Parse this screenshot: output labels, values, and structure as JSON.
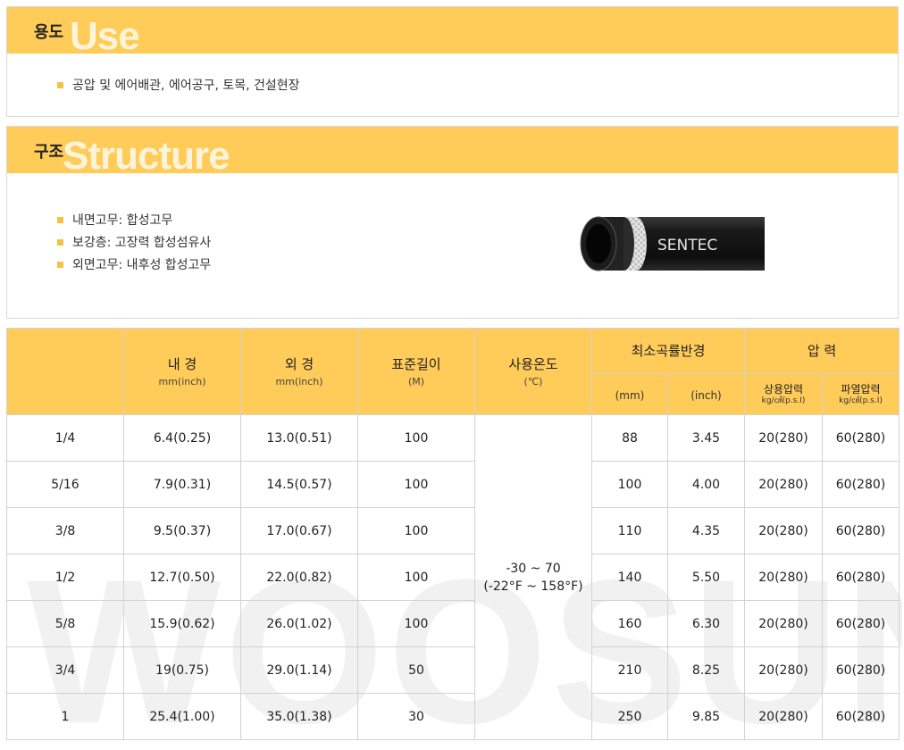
{
  "use_section": {
    "title": "용도",
    "ghost": "Use",
    "items": [
      "공압 및 에어배관, 에어공구, 토목, 건설현장"
    ]
  },
  "structure_section": {
    "title": "구조",
    "ghost": "Structure",
    "items": [
      "내면고무: 합성고무",
      "보강층: 고장력 합성섬유사",
      "외면고무: 내후성 합성고무"
    ],
    "hose_brand": "SENTEC"
  },
  "table": {
    "headers": {
      "inner_diameter": "내 경",
      "inner_diameter_unit": "mm(inch)",
      "outer_diameter": "외 경",
      "outer_diameter_unit": "mm(inch)",
      "length": "표준길이",
      "length_unit": "(M)",
      "temperature": "사용온도",
      "temperature_unit": "(℃)",
      "bend_radius": "최소곡률반경",
      "bend_mm": "(mm)",
      "bend_inch": "(inch)",
      "pressure": "압 력",
      "working_pressure": "상용압력",
      "burst_pressure": "파열압력",
      "pressure_unit": "kg/㎠(p.s.I)"
    },
    "temperature_value_line1": "-30 ~ 70",
    "temperature_value_line2": "(-22°F ~ 158°F)",
    "rows": [
      {
        "size": "1/4",
        "id": "6.4(0.25)",
        "od": "13.0(0.51)",
        "length": "100",
        "bend_mm": "88",
        "bend_inch": "3.45",
        "working": "20(280)",
        "burst": "60(280)"
      },
      {
        "size": "5/16",
        "id": "7.9(0.31)",
        "od": "14.5(0.57)",
        "length": "100",
        "bend_mm": "100",
        "bend_inch": "4.00",
        "working": "20(280)",
        "burst": "60(280)"
      },
      {
        "size": "3/8",
        "id": "9.5(0.37)",
        "od": "17.0(0.67)",
        "length": "100",
        "bend_mm": "110",
        "bend_inch": "4.35",
        "working": "20(280)",
        "burst": "60(280)"
      },
      {
        "size": "1/2",
        "id": "12.7(0.50)",
        "od": "22.0(0.82)",
        "length": "100",
        "bend_mm": "140",
        "bend_inch": "5.50",
        "working": "20(280)",
        "burst": "60(280)"
      },
      {
        "size": "5/8",
        "id": "15.9(0.62)",
        "od": "26.0(1.02)",
        "length": "100",
        "bend_mm": "160",
        "bend_inch": "6.30",
        "working": "20(280)",
        "burst": "60(280)"
      },
      {
        "size": "3/4",
        "id": "19(0.75)",
        "od": "29.0(1.14)",
        "length": "50",
        "bend_mm": "210",
        "bend_inch": "8.25",
        "working": "20(280)",
        "burst": "60(280)"
      },
      {
        "size": "1",
        "id": "25.4(1.00)",
        "od": "35.0(1.38)",
        "length": "30",
        "bend_mm": "250",
        "bend_inch": "9.85",
        "working": "20(280)",
        "burst": "60(280)"
      }
    ]
  },
  "watermark": "WOOSUNG",
  "colors": {
    "accent": "#ffcb59",
    "bullet": "#f4c242",
    "ghost_text": "#fff4d9",
    "border": "#d2d2d2"
  }
}
